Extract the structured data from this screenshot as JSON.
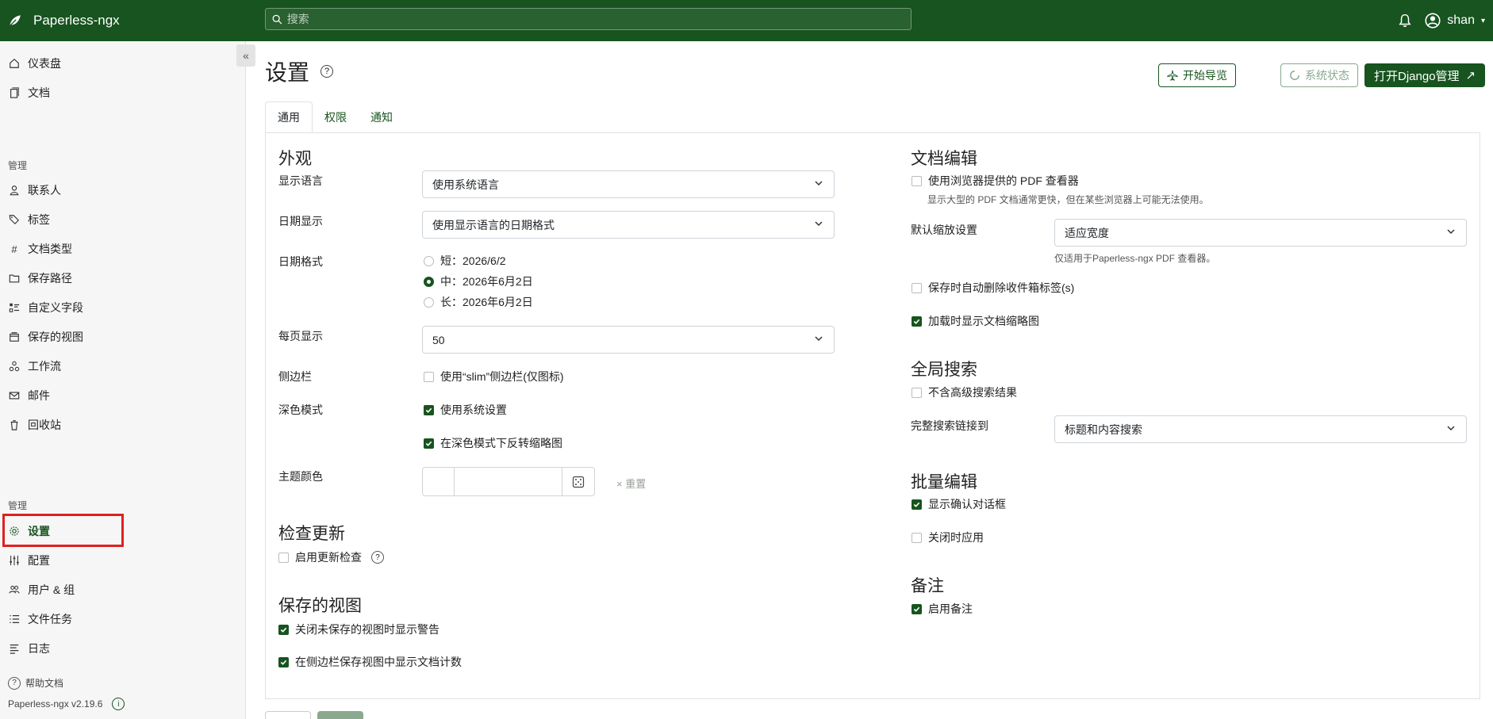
{
  "app": {
    "name": "Paperless-ngx"
  },
  "search": {
    "placeholder": "搜索"
  },
  "user": {
    "name": "shan"
  },
  "sidebar": {
    "items_top": [
      {
        "label": "仪表盘",
        "icon": "house-icon"
      },
      {
        "label": "文档",
        "icon": "documents-icon"
      }
    ],
    "section_manage_1": "管理",
    "items_manage": [
      {
        "label": "联系人",
        "icon": "person-icon"
      },
      {
        "label": "标签",
        "icon": "tags-icon"
      },
      {
        "label": "文档类型",
        "icon": "hash-icon"
      },
      {
        "label": "保存路径",
        "icon": "folder-icon"
      },
      {
        "label": "自定义字段",
        "icon": "ui-checks-icon"
      },
      {
        "label": "保存的视图",
        "icon": "window-stack-icon"
      },
      {
        "label": "工作流",
        "icon": "diagram-icon"
      },
      {
        "label": "邮件",
        "icon": "envelope-icon"
      },
      {
        "label": "回收站",
        "icon": "trash-icon"
      }
    ],
    "section_manage_2": "管理",
    "items_admin": [
      {
        "label": "设置",
        "icon": "gear-icon"
      },
      {
        "label": "配置",
        "icon": "sliders-icon"
      },
      {
        "label": "用户 & 组",
        "icon": "people-icon"
      },
      {
        "label": "文件任务",
        "icon": "list-task-icon"
      },
      {
        "label": "日志",
        "icon": "text-paragraph-icon"
      }
    ],
    "help": "帮助文档",
    "version": "Paperless-ngx v2.19.6"
  },
  "main": {
    "title": "设置",
    "buttons": {
      "tour": "开始导览",
      "status": "系统状态",
      "django": "打开Django管理"
    },
    "tabs": [
      "通用",
      "权限",
      "通知"
    ],
    "appearance": {
      "heading": "外观",
      "display_language_label": "显示语言",
      "display_language_value": "使用系统语言",
      "date_display_label": "日期显示",
      "date_display_value": "使用显示语言的日期格式",
      "date_format_label": "日期格式",
      "date_formats": [
        "短：2026/6/2",
        "中：2026年6月2日",
        "长：2026年6月2日"
      ],
      "date_format_selected": "中：2026年6月2日",
      "page_size_label": "每页显示",
      "page_size_value": "50",
      "sidebar_label": "侧边栏",
      "sidebar_slim": "使用“slim”侧边栏(仅图标)",
      "sidebar_slim_checked": false,
      "dark_mode_label": "深色模式",
      "dark_mode_system": "使用系统设置",
      "dark_mode_system_checked": true,
      "dark_mode_invert": "在深色模式下反转缩略图",
      "dark_mode_invert_checked": true,
      "theme_color_label": "主题颜色",
      "theme_color_reset": "重置"
    },
    "update_check": {
      "heading": "检查更新",
      "enable": "启用更新检查",
      "enable_checked": false
    },
    "saved_views": {
      "heading": "保存的视图",
      "warn_unsaved": "关闭未保存的视图时显示警告",
      "warn_unsaved_checked": true,
      "show_count": "在侧边栏保存视图中显示文档计数",
      "show_count_checked": true
    },
    "doc_edit": {
      "heading": "文档编辑",
      "browser_pdf": "使用浏览器提供的 PDF 查看器",
      "browser_pdf_checked": false,
      "browser_pdf_hint": "显示大型的 PDF 文档通常更快，但在某些浏览器上可能无法使用。",
      "zoom_label": "默认缩放设置",
      "zoom_value": "适应宽度",
      "zoom_hint": "仅适用于Paperless-ngx PDF 查看器。",
      "remove_inbox": "保存时自动删除收件箱标签(s)",
      "remove_inbox_checked": false,
      "show_thumbs": "加载时显示文档缩略图",
      "show_thumbs_checked": true
    },
    "global_search": {
      "heading": "全局搜索",
      "exclude_advanced": "不含高级搜索结果",
      "exclude_advanced_checked": false,
      "full_search_label": "完整搜索链接到",
      "full_search_value": "标题和内容搜索"
    },
    "bulk_edit": {
      "heading": "批量编辑",
      "confirm": "显示确认对话框",
      "confirm_checked": true,
      "apply_on_close": "关闭时应用",
      "apply_on_close_checked": false
    },
    "notes": {
      "heading": "备注",
      "enable": "启用备注",
      "enable_checked": true
    }
  },
  "colors": {
    "brand": "#17541f",
    "highlight": "#e02020"
  }
}
